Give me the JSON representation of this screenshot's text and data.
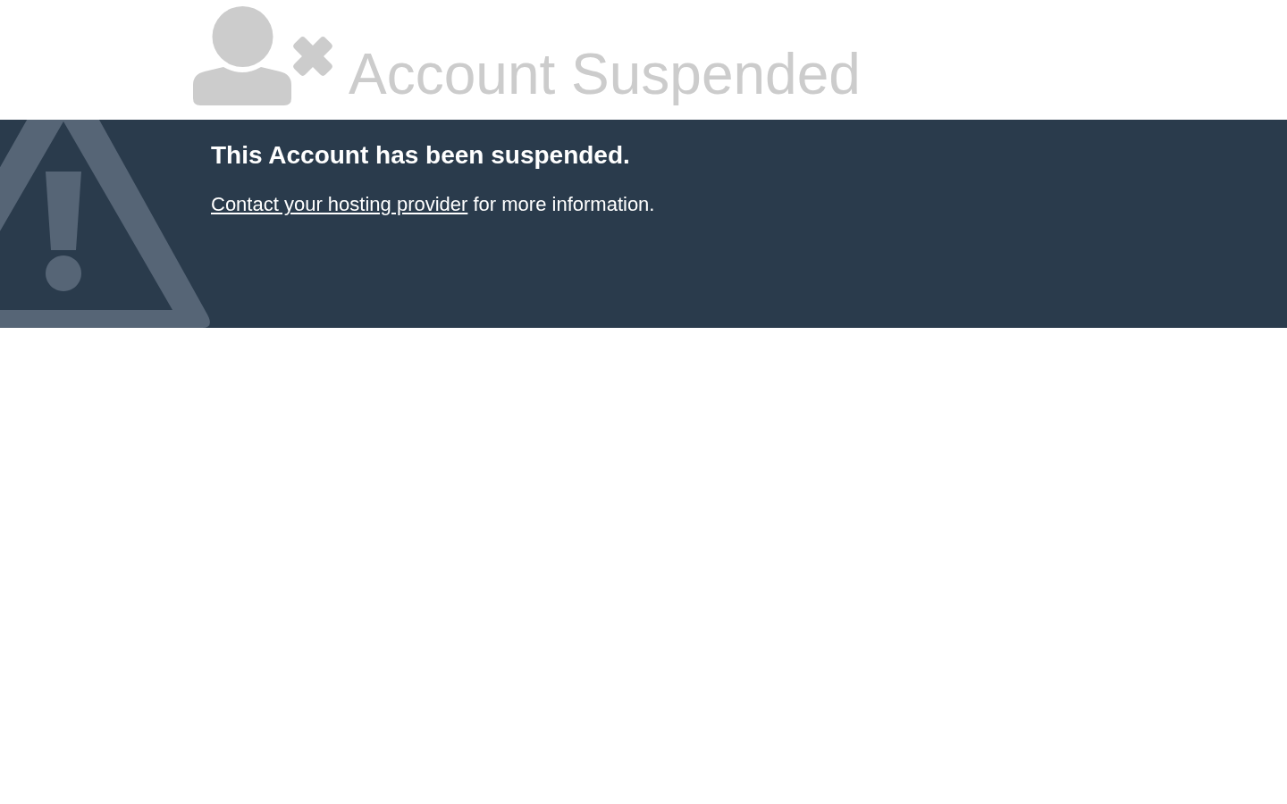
{
  "header": {
    "title": "Account Suspended"
  },
  "banner": {
    "heading": "This Account has been suspended.",
    "message": {
      "link": "Contact your hosting provider",
      "text": "for more information."
    }
  }
}
